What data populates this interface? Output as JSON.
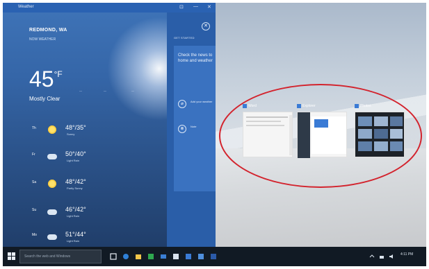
{
  "window": {
    "title": "Weather",
    "controls": [
      "⊡",
      "—",
      "✕"
    ]
  },
  "weather": {
    "city": "REDMOND, WA",
    "now_label": "NOW WEATHER",
    "temperature": "45",
    "unit": "°F",
    "condition": "Mostly Clear",
    "stats_top": [
      "—",
      "—",
      "—"
    ],
    "forecast": [
      {
        "day": "Th",
        "range": "48°/35°",
        "sub": "Sunny"
      },
      {
        "day": "Fr",
        "range": "50°/40°",
        "sub": "Light Rain"
      },
      {
        "day": "Sa",
        "range": "48°/42°",
        "sub": "Partly Sunny"
      },
      {
        "day": "Su",
        "range": "46°/42°",
        "sub": "Light Rain"
      },
      {
        "day": "Mo",
        "range": "51°/44°",
        "sub": "Light Rain"
      }
    ]
  },
  "news": {
    "header": "GET STARTED",
    "headline": "Check the news to home and weather",
    "close_glyph": "✕",
    "items": [
      {
        "glyph": "⌀",
        "text": "Add your weather"
      },
      {
        "glyph": "⊗",
        "text": "Note"
      }
    ]
  },
  "snap": [
    {
      "label": "Word"
    },
    {
      "label": "Explorer"
    },
    {
      "label": "Photos"
    }
  ],
  "taskbar": {
    "search_placeholder": "Search the web and Windows",
    "clock_time": "4:11 PM"
  }
}
